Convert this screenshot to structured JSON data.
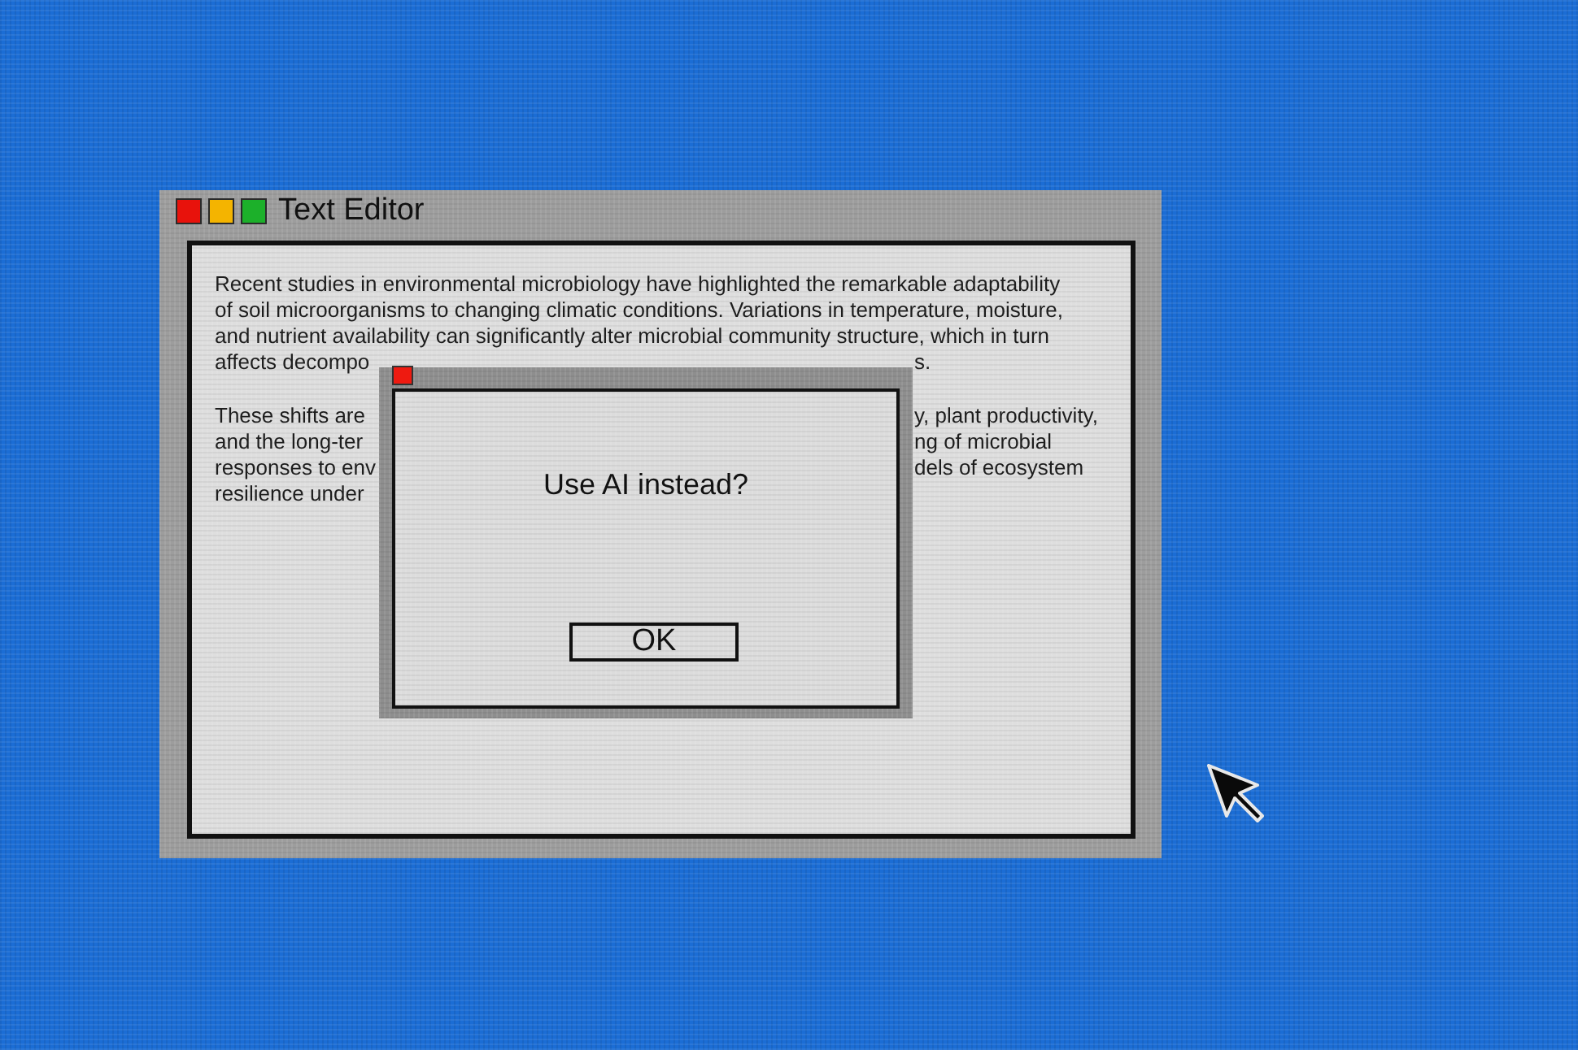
{
  "window": {
    "title": "Text Editor",
    "controls": [
      {
        "color": "#e8120c"
      },
      {
        "color": "#f4b400"
      },
      {
        "color": "#1cb02a"
      }
    ]
  },
  "document": {
    "paragraphs": [
      {
        "lines": [
          {
            "text": "Recent studies in environmental microbiology have highlighted the remarkable adaptability"
          },
          {
            "text": "of soil microorganisms to changing climatic conditions. Variations in temperature, moisture,"
          },
          {
            "text": "and nutrient availability can significantly alter microbial community structure, which in turn"
          },
          {
            "before_dialog": "affects decompo",
            "after_dialog": "s."
          }
        ]
      },
      {
        "lines": [
          {
            "before_dialog": "These shifts are",
            "after_dialog": "y, plant productivity,"
          },
          {
            "before_dialog": "and the long-ter",
            "after_dialog": "ng of microbial"
          },
          {
            "before_dialog": "responses to env",
            "after_dialog": "dels of ecosystem"
          },
          {
            "before_dialog": "resilience under"
          }
        ]
      }
    ]
  },
  "dialog": {
    "message": "Use AI instead?",
    "buttons": [
      "OK"
    ]
  }
}
